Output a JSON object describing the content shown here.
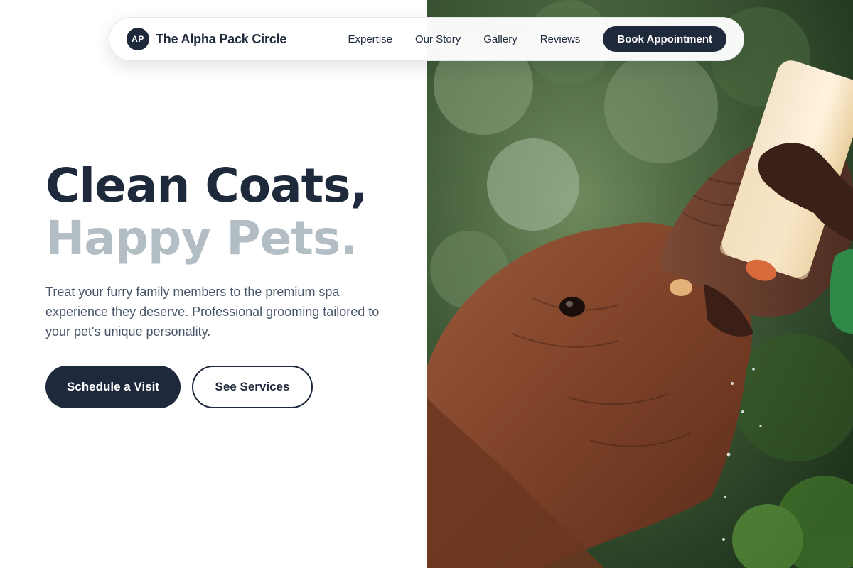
{
  "nav": {
    "badge": "AP",
    "brand_name": "The Alpha Pack Circle",
    "links": [
      {
        "label": "Expertise"
      },
      {
        "label": "Our Story"
      },
      {
        "label": "Gallery"
      },
      {
        "label": "Reviews"
      }
    ],
    "cta_label": "Book Appointment"
  },
  "hero": {
    "title_line1": "Clean Coats,",
    "title_line2": "Happy Pets.",
    "subtitle": "Treat your furry family members to the premium spa experience they deserve. Professional grooming tailored to your pet's unique personality.",
    "primary_button": "Schedule a Visit",
    "secondary_button": "See Services"
  },
  "photo": {
    "subject": "baby-elephant-bottle-feeding-photo"
  },
  "colors": {
    "primary": "#1e293b",
    "muted_heading": "#b3bdc4",
    "body_text": "#475569",
    "background": "#ffffff"
  }
}
